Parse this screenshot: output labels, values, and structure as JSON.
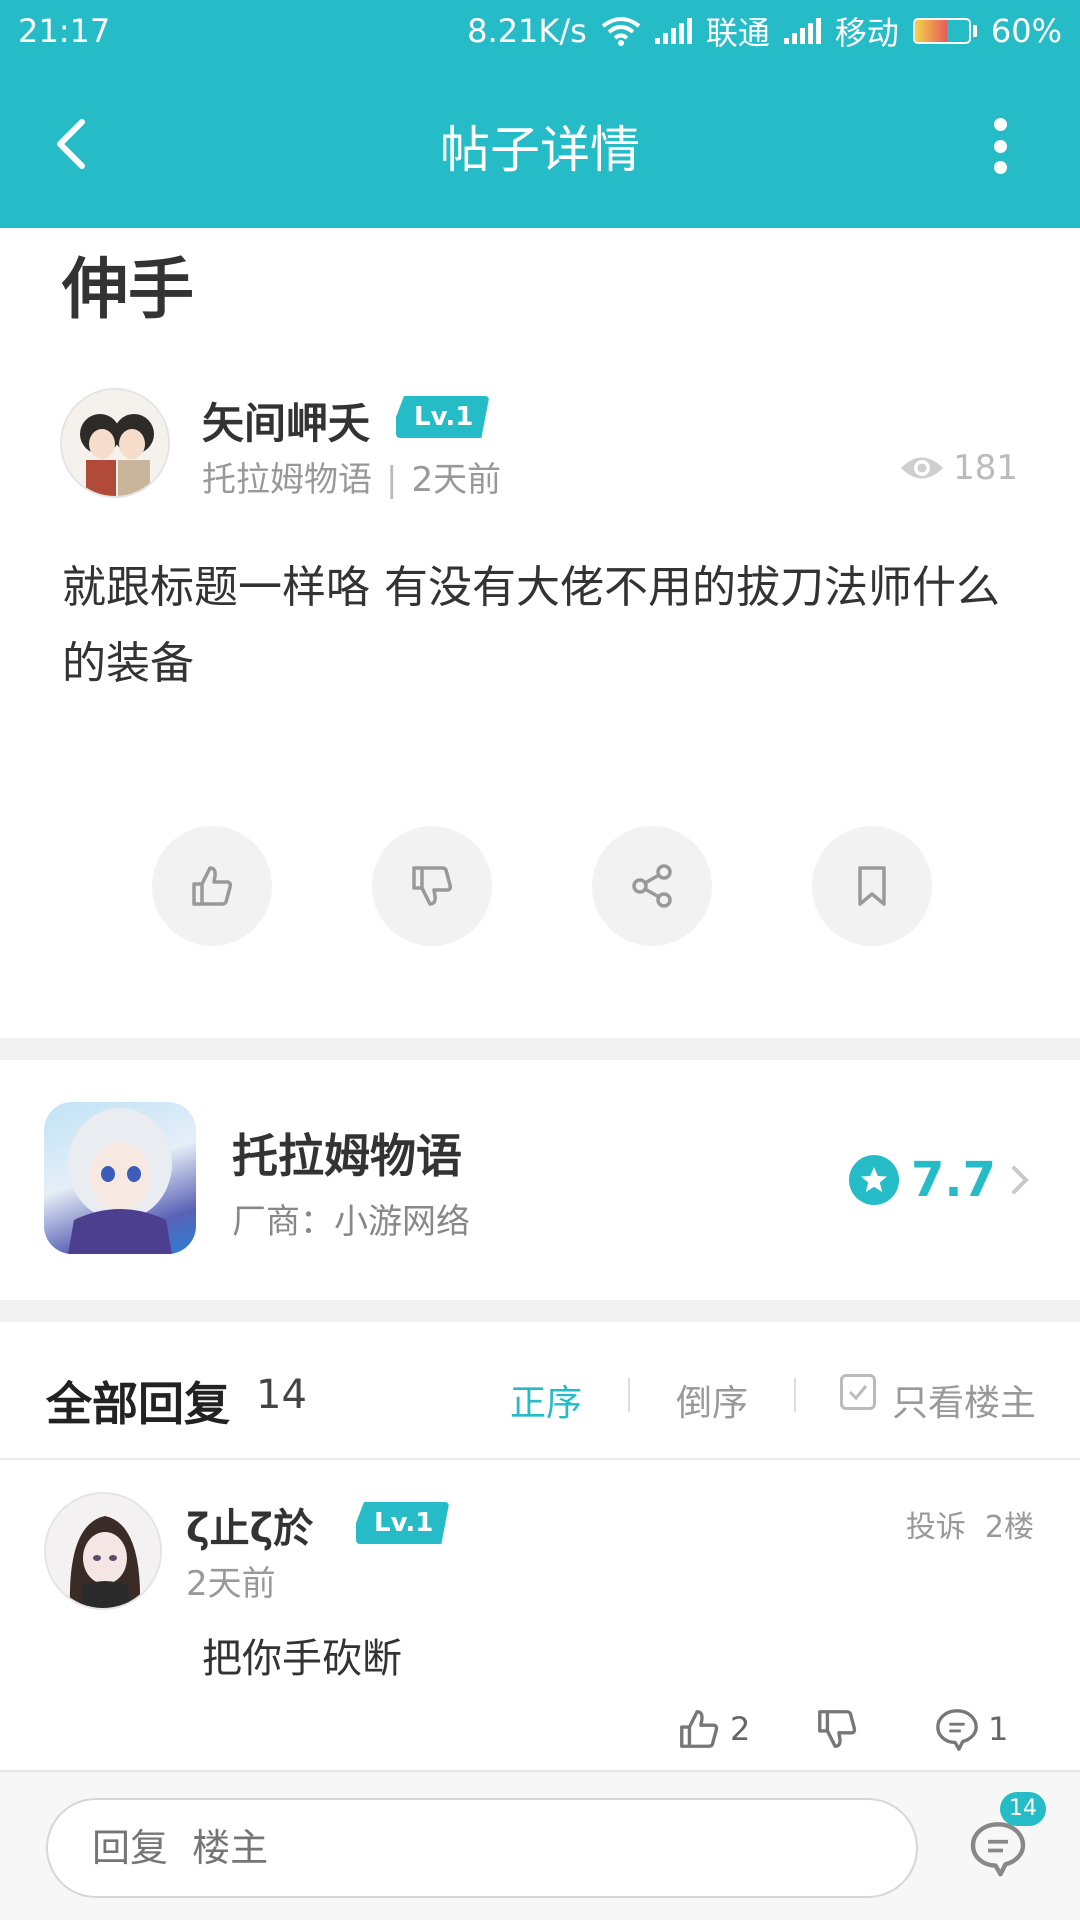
{
  "status_bar": {
    "time": "21:17",
    "speed": "8.21K/s",
    "carrier1": "联通",
    "carrier2": "移动",
    "battery": "60%",
    "battery_level": 0.6
  },
  "header": {
    "title": "帖子详情"
  },
  "post": {
    "title": "伸手",
    "author": "矢间岬夭",
    "level": "Lv.1",
    "forum": "托拉姆物语",
    "separator": "|",
    "time": "2天前",
    "views": "181",
    "body": "就跟标题一样咯 有没有大佬不用的拔刀法师什么的装备"
  },
  "game": {
    "name": "托拉姆物语",
    "vendor": "厂商：小游网络",
    "score": "7.7"
  },
  "replies": {
    "heading": "全部回复",
    "count": "14",
    "sort_asc": "正序",
    "sort_desc": "倒序",
    "only_op": "只看楼主"
  },
  "reply_items": [
    {
      "name": "ζ止ζ於",
      "level": "Lv.1",
      "report": "投诉",
      "floor": "2楼",
      "time": "2天前",
      "text": "把你手砍断",
      "likes": "2",
      "comments": "1"
    }
  ],
  "bottom_bar": {
    "placeholder": "回复  楼主",
    "badge": "14"
  },
  "colors": {
    "accent": "#25bcc8"
  }
}
